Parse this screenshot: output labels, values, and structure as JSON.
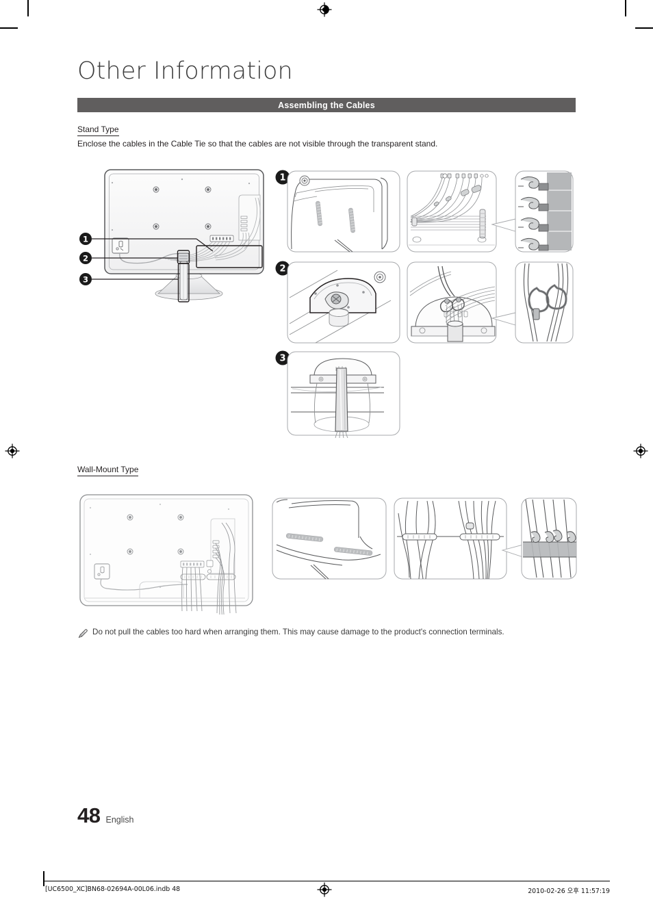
{
  "document": {
    "chapter_title": "Other Information",
    "section_bar_label": "Assembling the Cables",
    "page_number": "48",
    "language": "English"
  },
  "stand_type": {
    "heading": "Stand Type",
    "instruction": "Enclose the cables in the Cable Tie so that the cables are not visible through the transparent stand.",
    "callouts": [
      {
        "id": "1",
        "label": "1"
      },
      {
        "id": "2",
        "label": "2"
      },
      {
        "id": "3",
        "label": "3"
      }
    ],
    "steps": [
      {
        "number": "1",
        "panels": [
          "tv-corner-connectors",
          "cable-routing-clips",
          "clip-detail-zoom"
        ]
      },
      {
        "number": "2",
        "panels": [
          "stand-neck-base",
          "cable-tie-wrap",
          "cable-tie-detail-zoom"
        ]
      },
      {
        "number": "3",
        "panels": [
          "transparent-stand-cable-cover"
        ]
      }
    ]
  },
  "wall_mount_type": {
    "heading": "Wall-Mount Type",
    "panels": [
      "tv-rear-cable-layout",
      "tv-bottom-edge-clips",
      "cables-through-clips",
      "clip-detail-zoom"
    ]
  },
  "note": {
    "icon": "pencil-note-icon",
    "text": "Do not pull the cables too hard when arranging them. This may cause damage to the product's connection terminals."
  },
  "footer": {
    "file_reference": "[UC6500_XC]BN68-02694A-00L06.indb   48",
    "timestamp": "2010-02-26   오후 11:57:19"
  },
  "printer_marks": {
    "registration_icon": "registration-target-icon",
    "crop_mark_icon": "crop-mark-icon"
  },
  "colors": {
    "section_bar_bg": "#605e5e",
    "section_bar_text": "#ffffff",
    "text": "#231f20",
    "badge_bg": "#1a1a1a",
    "line": "#6d6e71",
    "shade": "#b5b7b9"
  }
}
